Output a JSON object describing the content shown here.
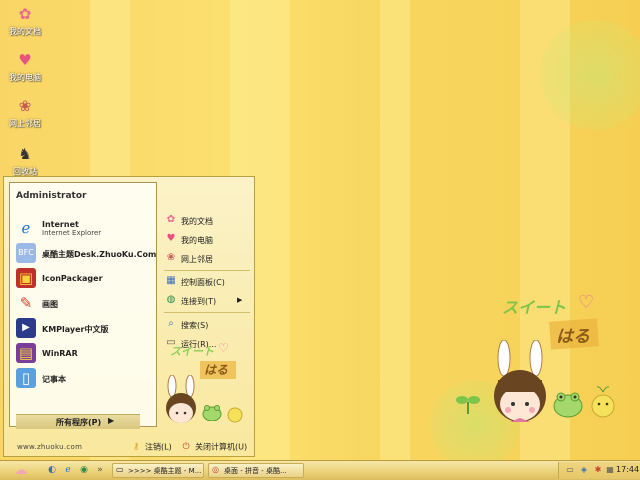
{
  "desktop": {
    "icons": [
      {
        "label": "我的文档",
        "icon": "documents-icon"
      },
      {
        "label": "我的电脑",
        "icon": "computer-icon"
      },
      {
        "label": "网上邻居",
        "icon": "network-icon"
      },
      {
        "label": "回收站",
        "icon": "recycle-bin-icon"
      }
    ],
    "sticker": {
      "line1": "スイート",
      "line2": "はる"
    }
  },
  "start_menu": {
    "user": "Administrator",
    "programs": [
      {
        "title": "Internet",
        "subtitle": "Internet Explorer",
        "icon": "internet-explorer-icon"
      },
      {
        "title": "桌酷主题Desk.ZhuoKu.Com",
        "icon": "zhuoku-icon"
      },
      {
        "title": "IconPackager",
        "icon": "iconpackager-icon"
      },
      {
        "title": "画图",
        "icon": "paint-icon"
      },
      {
        "title": "KMPlayer中文版",
        "icon": "kmplayer-icon"
      },
      {
        "title": "WinRAR",
        "icon": "winrar-icon"
      },
      {
        "title": "记事本",
        "icon": "notepad-icon"
      }
    ],
    "all_programs": "所有程序(P)",
    "brand": "www.zhuoku.com",
    "right_items": [
      {
        "label": "我的文档",
        "icon": "documents-icon"
      },
      {
        "label": "我的电脑",
        "icon": "computer-icon"
      },
      {
        "label": "网上邻居",
        "icon": "network-icon"
      },
      {
        "label": "控制面板(C)",
        "icon": "control-panel-icon"
      },
      {
        "label": "连接到(T)",
        "icon": "connect-icon"
      },
      {
        "label": "搜索(S)",
        "icon": "search-icon"
      },
      {
        "label": "运行(R)...",
        "icon": "run-icon"
      }
    ],
    "logoff": "注销(L)",
    "shutdown": "关闭计算机(U)"
  },
  "taskbar": {
    "tasks": [
      {
        "label": ">>>> 桌酷主题 - M...",
        "icon": "window-icon"
      },
      {
        "label": "桌面 - 拼音 - 桌酷...",
        "icon": "chrome-icon"
      }
    ],
    "clock": "17:44"
  },
  "colors": {
    "accent": "#f8d760",
    "pink": "#e8769a",
    "taskbar": "#ecd27a"
  }
}
